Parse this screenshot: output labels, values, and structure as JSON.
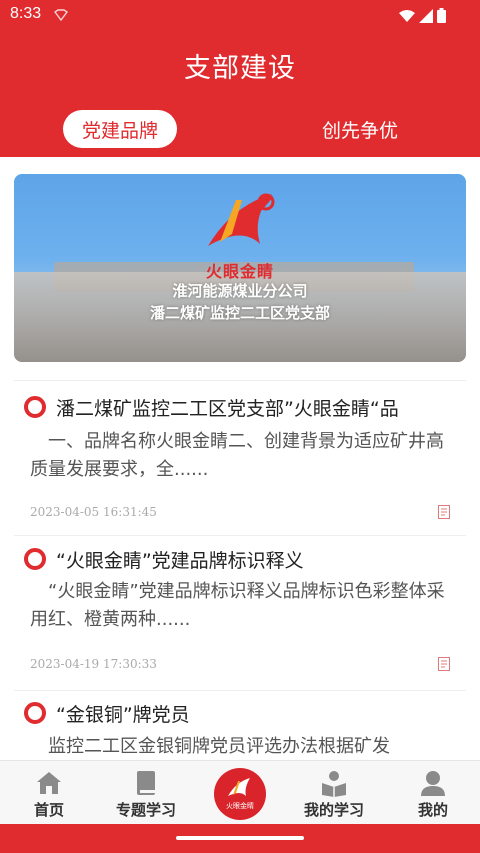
{
  "status_bar": {
    "time": "8:33"
  },
  "header": {
    "title": "支部建设",
    "tabs": [
      {
        "label": "党建品牌",
        "active": true
      },
      {
        "label": "创先争优",
        "active": false
      }
    ]
  },
  "banner": {
    "brand": "火眼金睛",
    "line1": "淮河能源煤业分公司",
    "line2": "潘二煤矿监控二工区党支部"
  },
  "articles": [
    {
      "title": "潘二煤矿监控二工区党支部”火眼金睛“品",
      "summary": "一、品牌名称火眼金睛二、创建背景为适应矿井高质量发展要求，全......",
      "date": "2023-04-05 16:31:45"
    },
    {
      "title": "“火眼金睛”党建品牌标识释义",
      "summary": "“火眼金睛”党建品牌标识释义品牌标识色彩整体采用红、橙黄两种......",
      "date": "2023-04-19 17:30:33"
    },
    {
      "title": "“金银铜”牌党员",
      "summary": "监控二工区金银铜牌党员评选办法根据矿发"
    }
  ],
  "bottom_nav": [
    {
      "label": "首页",
      "icon": "home-icon"
    },
    {
      "label": "专题学习",
      "icon": "book-icon"
    },
    {
      "label": "火眼金睛",
      "icon": "brand-logo-icon"
    },
    {
      "label": "我的学习",
      "icon": "reading-person-icon"
    },
    {
      "label": "我的",
      "icon": "user-icon"
    }
  ],
  "colors": {
    "primary": "#e02b2f",
    "text": "#222222",
    "muted": "#aaaaaa"
  }
}
